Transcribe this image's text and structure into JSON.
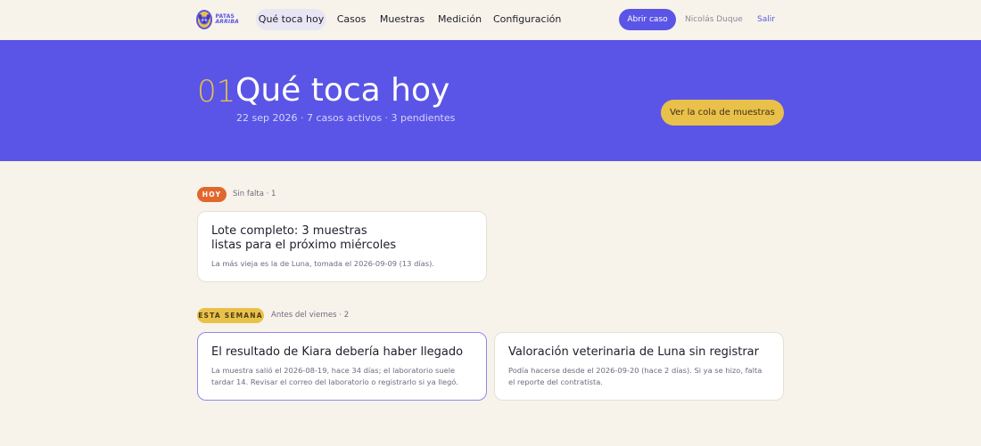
{
  "brand": {
    "logo_line1": "PATAS",
    "logo_line2": "ARRIBA"
  },
  "nav": {
    "items": [
      {
        "label": "Qué toca hoy",
        "active": true
      },
      {
        "label": "Casos"
      },
      {
        "label": "Muestras"
      },
      {
        "label": "Medición"
      },
      {
        "label": "Configuración"
      }
    ],
    "open_case_label": "Abrir caso",
    "user_name": "Nicolás Duque",
    "logout_label": "Salir"
  },
  "hero": {
    "number": "01",
    "title": "Qué toca hoy",
    "subtitle": "22 sep 2026 · 7 casos activos · 3 pendientes",
    "queue_button": "Ver la cola de muestras"
  },
  "groups": [
    {
      "tag": "HOY",
      "meta": "Sin falta · 1",
      "cards": [
        {
          "title_line1": "Lote completo: 3 muestras",
          "title_line2": "listas para el próximo miércoles",
          "desc": "La más vieja es la de Luna, tomada el 2026-09-09 (13 días)."
        }
      ]
    },
    {
      "tag": "ESTA SEMANA",
      "meta": "Antes del viernes · 2",
      "cards": [
        {
          "title": "El resultado de Kiara debería haber llegado",
          "desc": "La muestra salió el 2026-08-19, hace 34 días; el laboratorio suele tardar 14. Revisar el correo del laboratorio o registrarlo si ya llegó."
        },
        {
          "title": "Valoración veterinaria de Luna sin registrar",
          "desc": "Podía hacerse desde el 2026-09-20 (hace 2 días). Si ya se hizo, falta el reporte del contratista."
        }
      ]
    }
  ],
  "colors": {
    "primary": "#5a55e6",
    "accent": "#e9c14a",
    "urgent": "#e2672d",
    "background": "#f7f3ea"
  }
}
